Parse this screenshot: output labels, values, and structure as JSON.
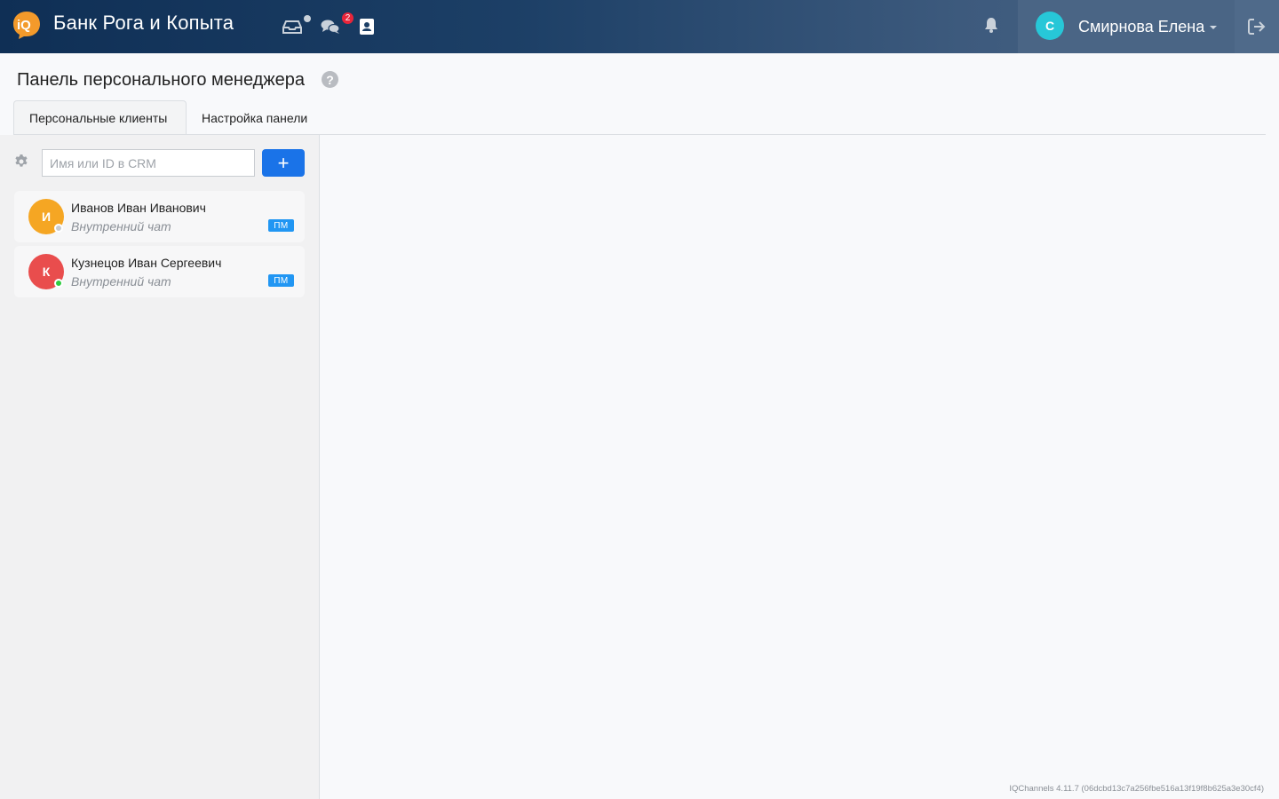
{
  "header": {
    "brand": "Банк Рога и Копыта",
    "logo_icon": "iq-logo-icon",
    "chats_badge": "2",
    "user": {
      "initial": "С",
      "name": "Смирнова Елена",
      "avatar_color": "#27c7d8"
    }
  },
  "page": {
    "title": "Панель персонального менеджера"
  },
  "tabs": [
    {
      "label": "Персональные клиенты",
      "active": true
    },
    {
      "label": "Настройка панели",
      "active": false
    }
  ],
  "sidebar": {
    "search_placeholder": "Имя или ID в CRM",
    "add_label": "+",
    "clients": [
      {
        "initial": "И",
        "name": "Иванов Иван Иванович",
        "channel": "Внутренний чат",
        "tag": "ПМ",
        "avatar_color": "#f5a623",
        "presence_color": "#c8ccd1"
      },
      {
        "initial": "К",
        "name": "Кузнецов Иван Сергеевич",
        "channel": "Внутренний чат",
        "tag": "ПМ",
        "avatar_color": "#e94d4d",
        "presence_color": "#2ecc40"
      }
    ]
  },
  "footer": {
    "version": "IQChannels 4.11.7 (06dcbd13c7a256fbe516a13f19f8b625a3e30cf4)"
  }
}
